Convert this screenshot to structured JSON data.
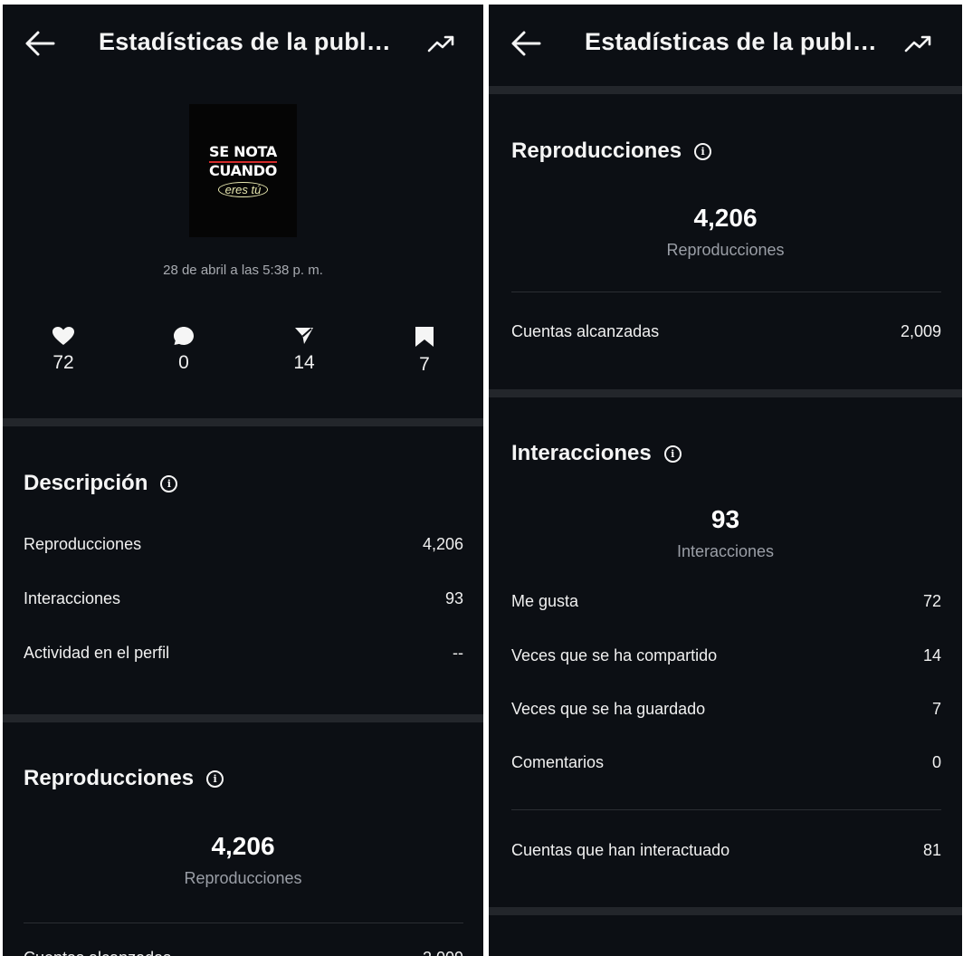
{
  "header": {
    "title": "Estadísticas de la publ…"
  },
  "post": {
    "thumbnail_lines": [
      "SE NOTA",
      "CUANDO",
      "eres tú"
    ],
    "date": "28 de abril a las 5:38 p. m."
  },
  "quick_stats": [
    {
      "icon": "heart-icon",
      "value": "72"
    },
    {
      "icon": "comment-icon",
      "value": "0"
    },
    {
      "icon": "share-icon",
      "value": "14"
    },
    {
      "icon": "bookmark-icon",
      "value": "7"
    }
  ],
  "overview": {
    "title": "Descripción",
    "rows": [
      {
        "label": "Reproducciones",
        "value": "4,206"
      },
      {
        "label": "Interacciones",
        "value": "93"
      },
      {
        "label": "Actividad en el perfil",
        "value": "--"
      }
    ]
  },
  "views": {
    "title": "Reproducciones",
    "total": "4,206",
    "total_label": "Reproducciones",
    "rows": [
      {
        "label": "Cuentas alcanzadas",
        "value": "2,009"
      }
    ]
  },
  "interactions": {
    "title": "Interacciones",
    "total": "93",
    "total_label": "Interacciones",
    "rows": [
      {
        "label": "Me gusta",
        "value": "72"
      },
      {
        "label": "Veces que se ha compartido",
        "value": "14"
      },
      {
        "label": "Veces que se ha guardado",
        "value": "7"
      },
      {
        "label": "Comentarios",
        "value": "0"
      }
    ],
    "accounts_row": {
      "label": "Cuentas que han interactuado",
      "value": "81"
    }
  },
  "colors": {
    "background": "#0c0f14",
    "divider": "#23262b",
    "muted_text": "#9a9ea6"
  }
}
